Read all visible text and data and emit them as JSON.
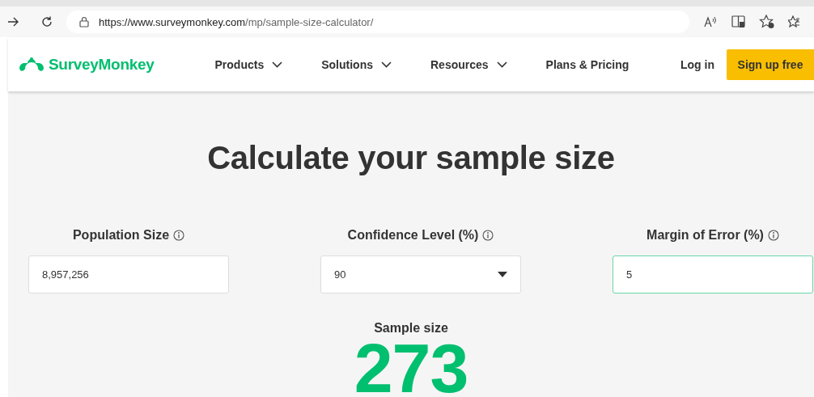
{
  "browser": {
    "url_host": "https://www.surveymonkey.com",
    "url_path": "/mp/sample-size-calculator/"
  },
  "site_header": {
    "logo": "SurveyMonkey",
    "nav": [
      {
        "label": "Products",
        "dropdown": true
      },
      {
        "label": "Solutions",
        "dropdown": true
      },
      {
        "label": "Resources",
        "dropdown": true
      },
      {
        "label": "Plans & Pricing",
        "dropdown": false
      }
    ],
    "login": "Log in",
    "signup": "Sign up free"
  },
  "calculator": {
    "title": "Calculate your sample size",
    "fields": [
      {
        "label": "Population Size",
        "kind": "text",
        "value": "8,957,256",
        "focused": false
      },
      {
        "label": "Confidence Level (%)",
        "kind": "select",
        "value": "90",
        "focused": false
      },
      {
        "label": "Margin of Error (%)",
        "kind": "text",
        "value": "5",
        "focused": true
      }
    ],
    "result_label": "Sample size",
    "result_value": "273"
  }
}
